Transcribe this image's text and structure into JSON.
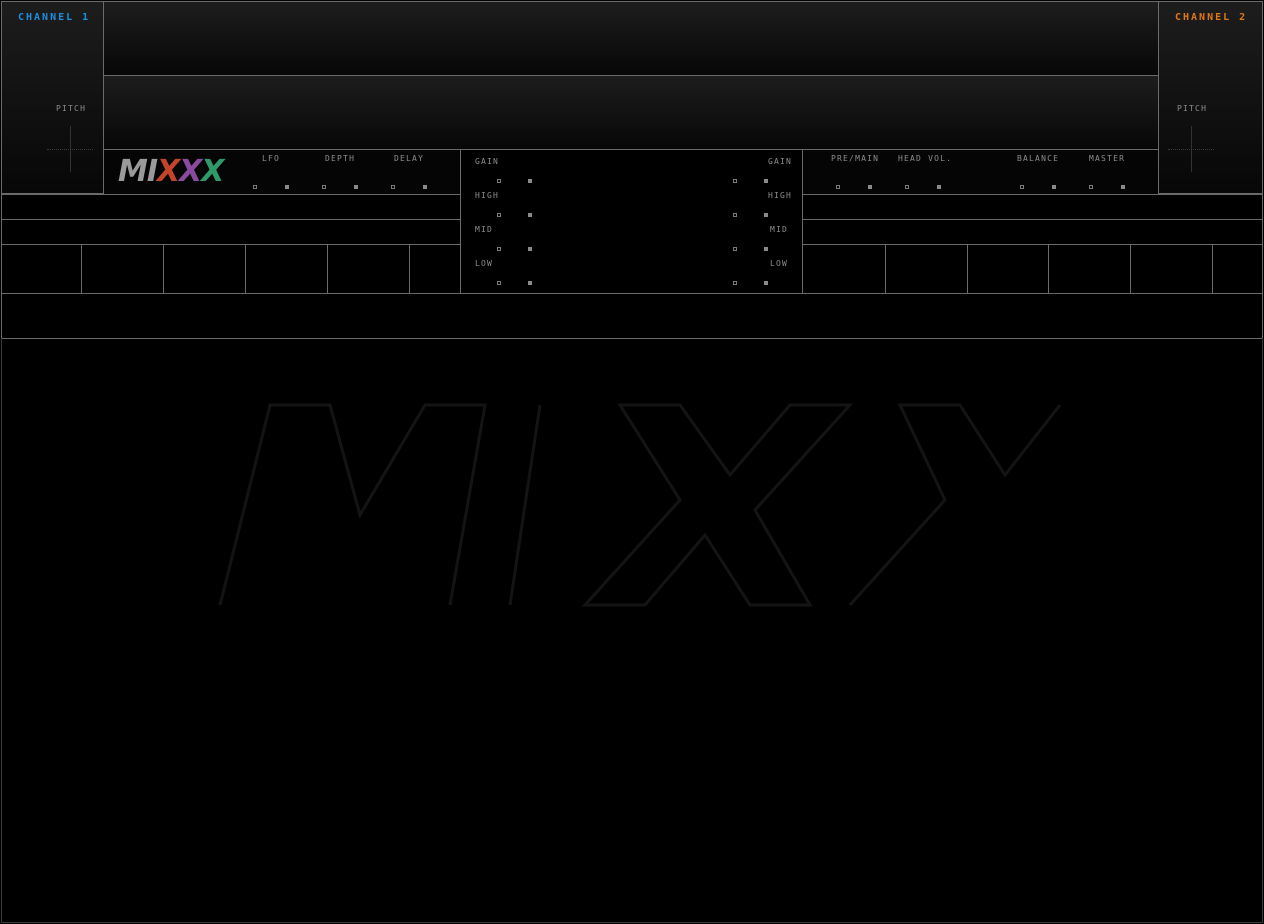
{
  "channel1": {
    "title": "CHANNEL 1",
    "pitch_label": "PITCH"
  },
  "channel2": {
    "title": "CHANNEL 2",
    "pitch_label": "PITCH"
  },
  "logo": {
    "text": "MIXX"
  },
  "flanger": {
    "lfo": "LFO",
    "depth": "DEPTH",
    "delay": "DELAY"
  },
  "eq_left": {
    "gain": "GAIN",
    "high": "HIGH",
    "mid": "MID",
    "low": "LOW"
  },
  "eq_right": {
    "gain": "GAIN",
    "high": "HIGH",
    "mid": "MID",
    "low": "LOW"
  },
  "master": {
    "pre_main": "PRE/MAIN",
    "head_vol": "HEAD VOL.",
    "balance": "BALANCE",
    "master": "MASTER"
  },
  "colors": {
    "channel1": "#1d8fe0",
    "channel2": "#e07818",
    "background": "#000000",
    "border": "#6a6a6a"
  }
}
